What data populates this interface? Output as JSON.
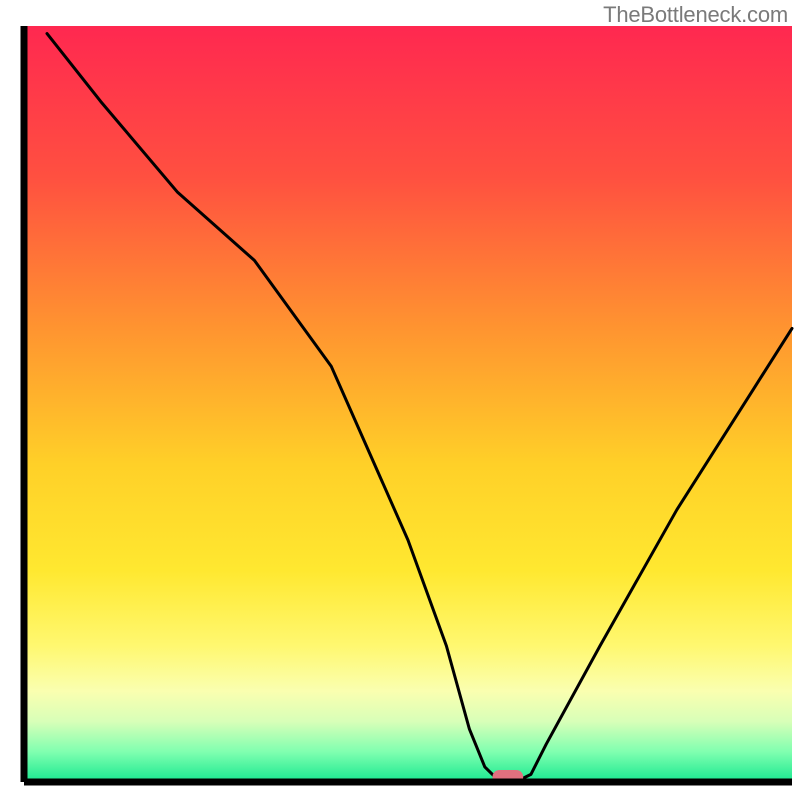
{
  "watermark": "TheBottleneck.com",
  "chart_data": {
    "type": "line",
    "title": "",
    "xlabel": "",
    "ylabel": "",
    "xlim": [
      0,
      100
    ],
    "ylim": [
      0,
      100
    ],
    "series": [
      {
        "name": "bottleneck-curve",
        "x": [
          3,
          10,
          20,
          30,
          40,
          50,
          55,
          58,
          60,
          62,
          64,
          66,
          68,
          75,
          85,
          95,
          100
        ],
        "values": [
          99,
          90,
          78,
          69,
          55,
          32,
          18,
          7,
          2,
          0,
          0,
          1,
          5,
          18,
          36,
          52,
          60
        ]
      }
    ],
    "marker": {
      "x_center": 63,
      "y": 0,
      "width": 4,
      "color": "#e1707f"
    },
    "gradient_stops": [
      {
        "offset": 0,
        "color": "#ff2850"
      },
      {
        "offset": 20,
        "color": "#ff5040"
      },
      {
        "offset": 40,
        "color": "#ff9430"
      },
      {
        "offset": 58,
        "color": "#ffd028"
      },
      {
        "offset": 72,
        "color": "#ffe830"
      },
      {
        "offset": 82,
        "color": "#fff870"
      },
      {
        "offset": 88,
        "color": "#faffb0"
      },
      {
        "offset": 92,
        "color": "#d8ffb8"
      },
      {
        "offset": 96,
        "color": "#80ffb0"
      },
      {
        "offset": 100,
        "color": "#18e890"
      }
    ],
    "axis_color": "#000000",
    "curve_color": "#000000"
  }
}
